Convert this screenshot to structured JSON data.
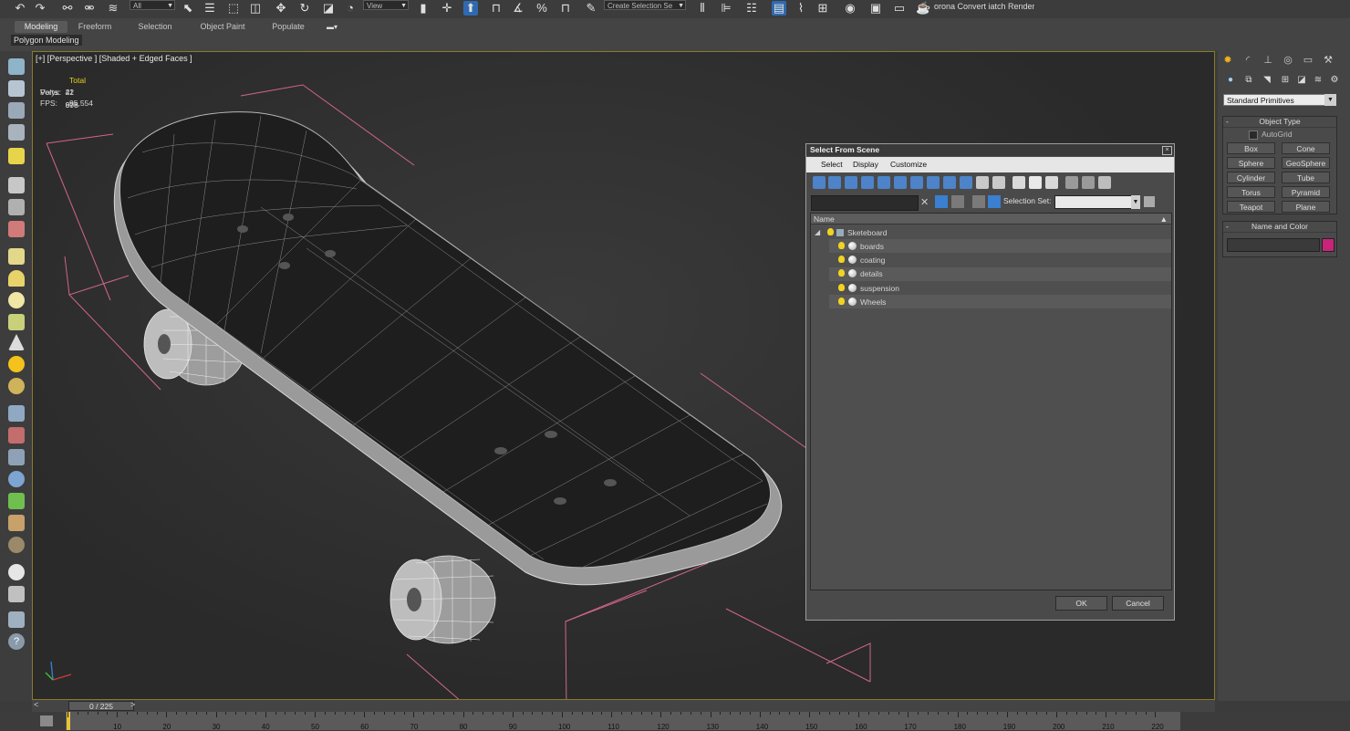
{
  "toolbar": {
    "filter_dropdown": "All",
    "coord_dropdown": "View",
    "selection_set_dropdown": "Create Selection Se",
    "render_label": "orona Convert iatch Render..."
  },
  "ribbon": {
    "tabs": [
      "Modeling",
      "Freeform",
      "Selection",
      "Object Paint",
      "Populate"
    ],
    "active_tab": "Modeling",
    "subpanel": "Polygon Modeling"
  },
  "viewport": {
    "label": "[+] [Perspective ] [Shaded + Edged Faces ]",
    "stats_header": "Total",
    "polys_label": "Polys:",
    "polys_value": "42 676",
    "verts_label": "Verts:",
    "verts_value": "21 908",
    "fps_label": "FPS:",
    "fps_value": "95,554"
  },
  "dialog": {
    "title": "Select From Scene",
    "close_glyph": "×",
    "menu": [
      "Select",
      "Display",
      "Customize"
    ],
    "selection_set_label": "Selection Set:",
    "column_name": "Name",
    "tree": {
      "root": "Sketeboard",
      "children": [
        "boards",
        "coating",
        "details",
        "suspension",
        "Wheels"
      ]
    },
    "ok_label": "OK",
    "cancel_label": "Cancel"
  },
  "command_panel": {
    "primitive_type": "Standard Primitives",
    "object_type_title": "Object Type",
    "autogrid_label": "AutoGrid",
    "buttons": [
      "Box",
      "Cone",
      "Sphere",
      "GeoSphere",
      "Cylinder",
      "Tube",
      "Torus",
      "Pyramid",
      "Teapot",
      "Plane"
    ],
    "name_color_title": "Name and Color",
    "object_color": "#c8247a"
  },
  "timeline": {
    "slider_label": "0 / 225",
    "prev_glyph": "<",
    "next_glyph": ">",
    "ticks": [
      "0",
      "10",
      "20",
      "30",
      "40",
      "50",
      "60",
      "70",
      "80",
      "90",
      "100",
      "110",
      "120",
      "130",
      "140",
      "150",
      "160",
      "170",
      "180",
      "190",
      "200",
      "210",
      "220"
    ]
  },
  "colors": {
    "stats_text": "#e8d21c",
    "bbox_lines": "#d0668a",
    "active_border": "#8a7a2a"
  }
}
